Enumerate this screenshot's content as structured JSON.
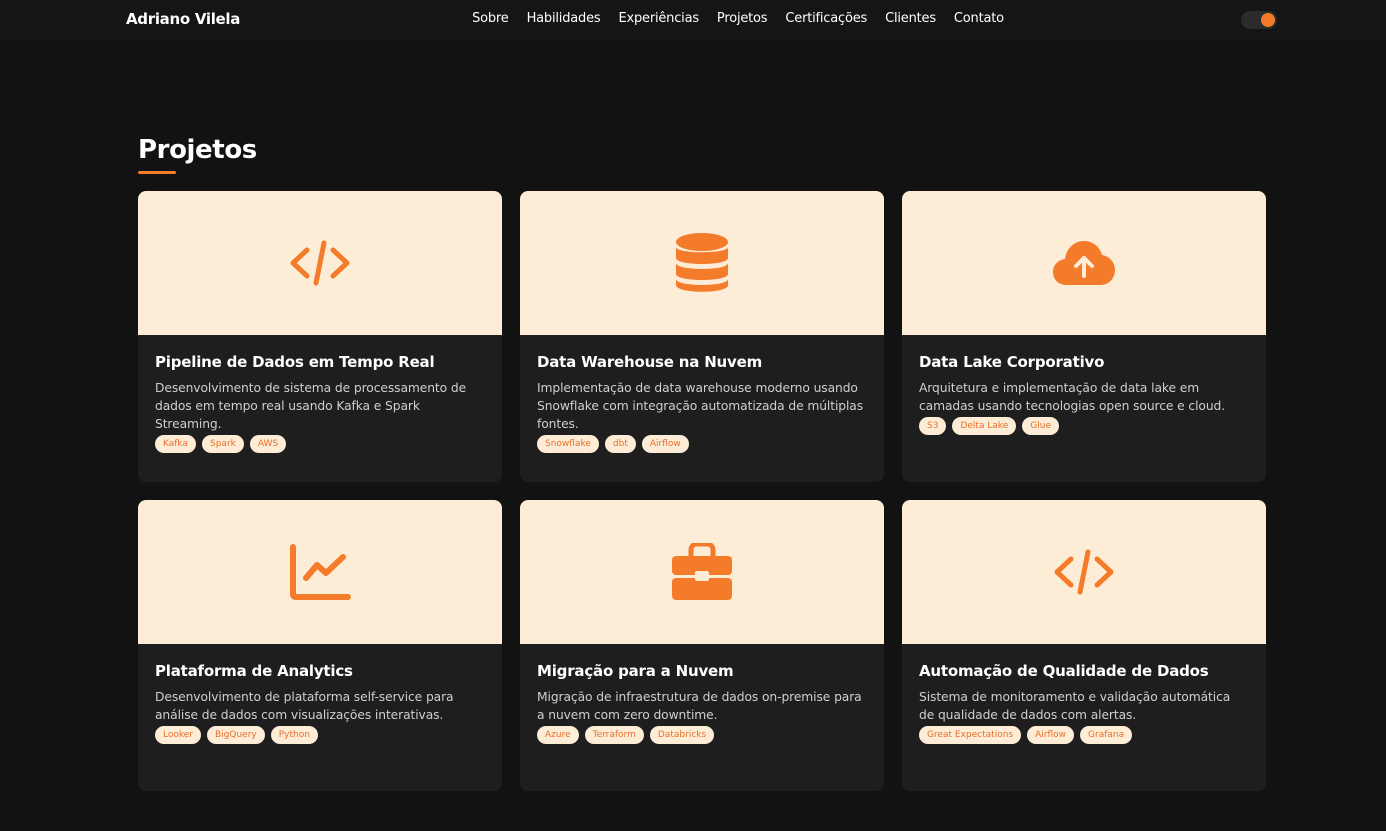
{
  "brand": "Adriano Vilela",
  "nav": [
    "Sobre",
    "Habilidades",
    "Experiências",
    "Projetos",
    "Certificações",
    "Clientes",
    "Contato"
  ],
  "section_title": "Projetos",
  "colors": {
    "accent": "#f47b2a",
    "card_top": "#fdecd6",
    "background": "#121212",
    "card": "#1e1e1f"
  },
  "projects": [
    {
      "icon": "code-icon",
      "title": "Pipeline de Dados em Tempo Real",
      "description": "Desenvolvimento de sistema de processamento de dados em tempo real usando Kafka e Spark Streaming.",
      "tags": [
        "Kafka",
        "Spark",
        "AWS"
      ]
    },
    {
      "icon": "database-icon",
      "title": "Data Warehouse na Nuvem",
      "description": "Implementação de data warehouse moderno usando Snowflake com integração automatizada de múltiplas fontes.",
      "tags": [
        "Snowflake",
        "dbt",
        "Airflow"
      ]
    },
    {
      "icon": "cloud-upload-icon",
      "title": "Data Lake Corporativo",
      "description": "Arquitetura e implementação de data lake em camadas usando tecnologias open source e cloud.",
      "tags": [
        "S3",
        "Delta Lake",
        "Glue"
      ]
    },
    {
      "icon": "chart-line-icon",
      "title": "Plataforma de Analytics",
      "description": "Desenvolvimento de plataforma self-service para análise de dados com visualizações interativas.",
      "tags": [
        "Looker",
        "BigQuery",
        "Python"
      ]
    },
    {
      "icon": "briefcase-icon",
      "title": "Migração para a Nuvem",
      "description": "Migração de infraestrutura de dados on-premise para a nuvem com zero downtime.",
      "tags": [
        "Azure",
        "Terraform",
        "Databricks"
      ]
    },
    {
      "icon": "code-icon",
      "title": "Automação de Qualidade de Dados",
      "description": "Sistema de monitoramento e validação automática de qualidade de dados com alertas.",
      "tags": [
        "Great Expectations",
        "Airflow",
        "Grafana"
      ]
    }
  ]
}
